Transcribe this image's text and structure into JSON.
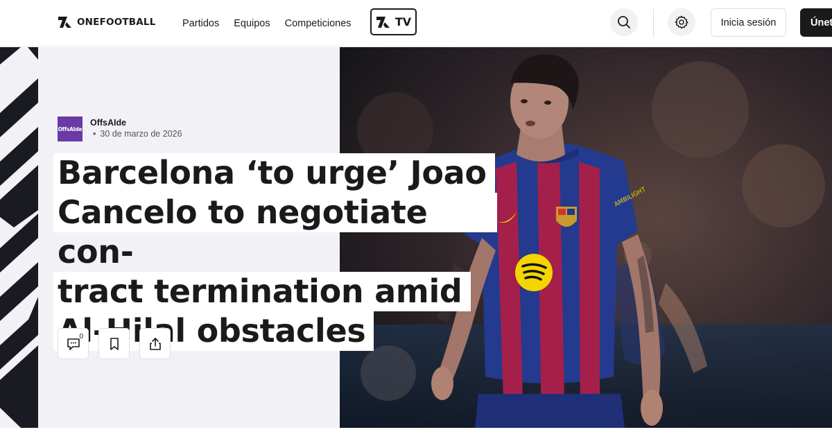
{
  "header": {
    "brand": "ONEFOOTBALL",
    "nav_links": [
      "Partidos",
      "Equipos",
      "Competiciones"
    ],
    "tv_label": "TV",
    "login_label": "Inicia sesión",
    "join_label": "Únete"
  },
  "article": {
    "source_logo_text": "OffsAIde",
    "source_name": "OffsAIde",
    "date": "30 de marzo de 2026",
    "headline_lines": [
      "Barcelona ‘to urge’ Joao",
      "Cancelo to negotiate con-",
      "tract termination amid",
      "Al-Hilal obstacles"
    ],
    "comment_count": "0",
    "photo_description_icons": {
      "sponsor_chest": "spotify-logo",
      "crest": "fc-barcelona-crest"
    }
  },
  "colors": {
    "accent": "#1a1a1a",
    "hero_panel": "#f2f2f6",
    "source_logo_bg": "#6a3aa6",
    "kit_blue": "#233a8f",
    "kit_red": "#a4204a"
  }
}
